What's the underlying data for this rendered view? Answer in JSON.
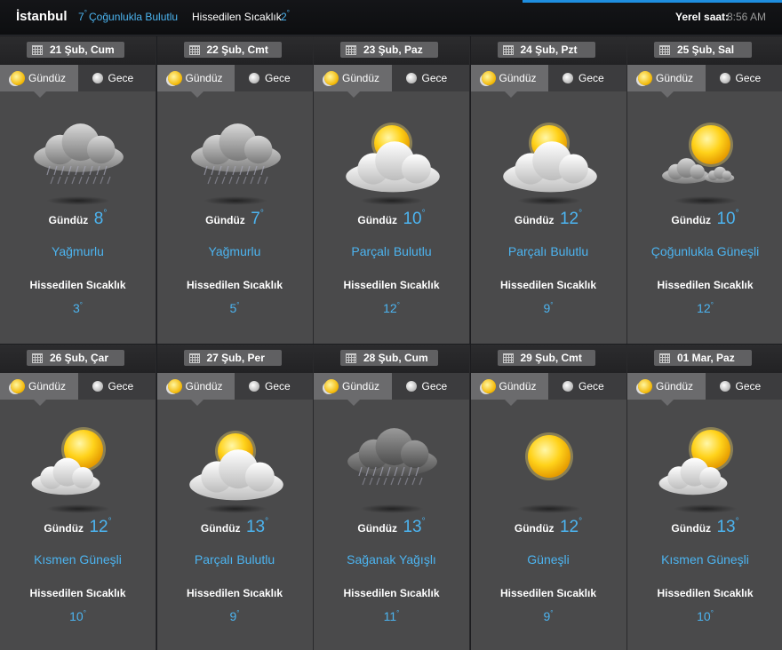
{
  "header": {
    "city": "İstanbul",
    "current_temp": "7",
    "current_condition": "Çoğunlukla Bulutlu",
    "feels_label": "Hissedilen Sıcaklık",
    "feels_value": "2",
    "local_time_label": "Yerel saat:",
    "local_time": "8:56 AM"
  },
  "labels": {
    "day_tab": "Gündüz",
    "night_tab": "Gece",
    "day_prefix": "Gündüz",
    "feels": "Hissedilen Sıcaklık"
  },
  "days": [
    {
      "date": "21 Şub, Cum",
      "temp": "8",
      "condition": "Yağmurlu",
      "feels": "3",
      "icon": "rain-cloud-icon"
    },
    {
      "date": "22 Şub, Cmt",
      "temp": "7",
      "condition": "Yağmurlu",
      "feels": "5",
      "icon": "rain-cloud-icon"
    },
    {
      "date": "23 Şub, Paz",
      "temp": "10",
      "condition": "Parçalı Bulutlu",
      "feels": "12",
      "icon": "partly-cloudy-icon"
    },
    {
      "date": "24 Şub, Pzt",
      "temp": "12",
      "condition": "Parçalı Bulutlu",
      "feels": "9",
      "icon": "partly-cloudy-icon"
    },
    {
      "date": "25 Şub, Sal",
      "temp": "10",
      "condition": "Çoğunlukla Güneşli",
      "feels": "12",
      "icon": "mostly-sunny-icon"
    },
    {
      "date": "26 Şub, Çar",
      "temp": "12",
      "condition": "Kısmen Güneşli",
      "feels": "10",
      "icon": "partly-sunny-icon"
    },
    {
      "date": "27 Şub, Per",
      "temp": "13",
      "condition": "Parçalı Bulutlu",
      "feels": "9",
      "icon": "partly-cloudy-icon"
    },
    {
      "date": "28 Şub, Cum",
      "temp": "13",
      "condition": "Sağanak Yağışlı",
      "feels": "11",
      "icon": "storm-cloud-icon"
    },
    {
      "date": "29 Şub, Cmt",
      "temp": "12",
      "condition": "Güneşli",
      "feels": "9",
      "icon": "sun-icon"
    },
    {
      "date": "01 Mar, Paz",
      "temp": "13",
      "condition": "Kısmen Güneşli",
      "feels": "10",
      "icon": "partly-sunny-icon"
    }
  ]
}
